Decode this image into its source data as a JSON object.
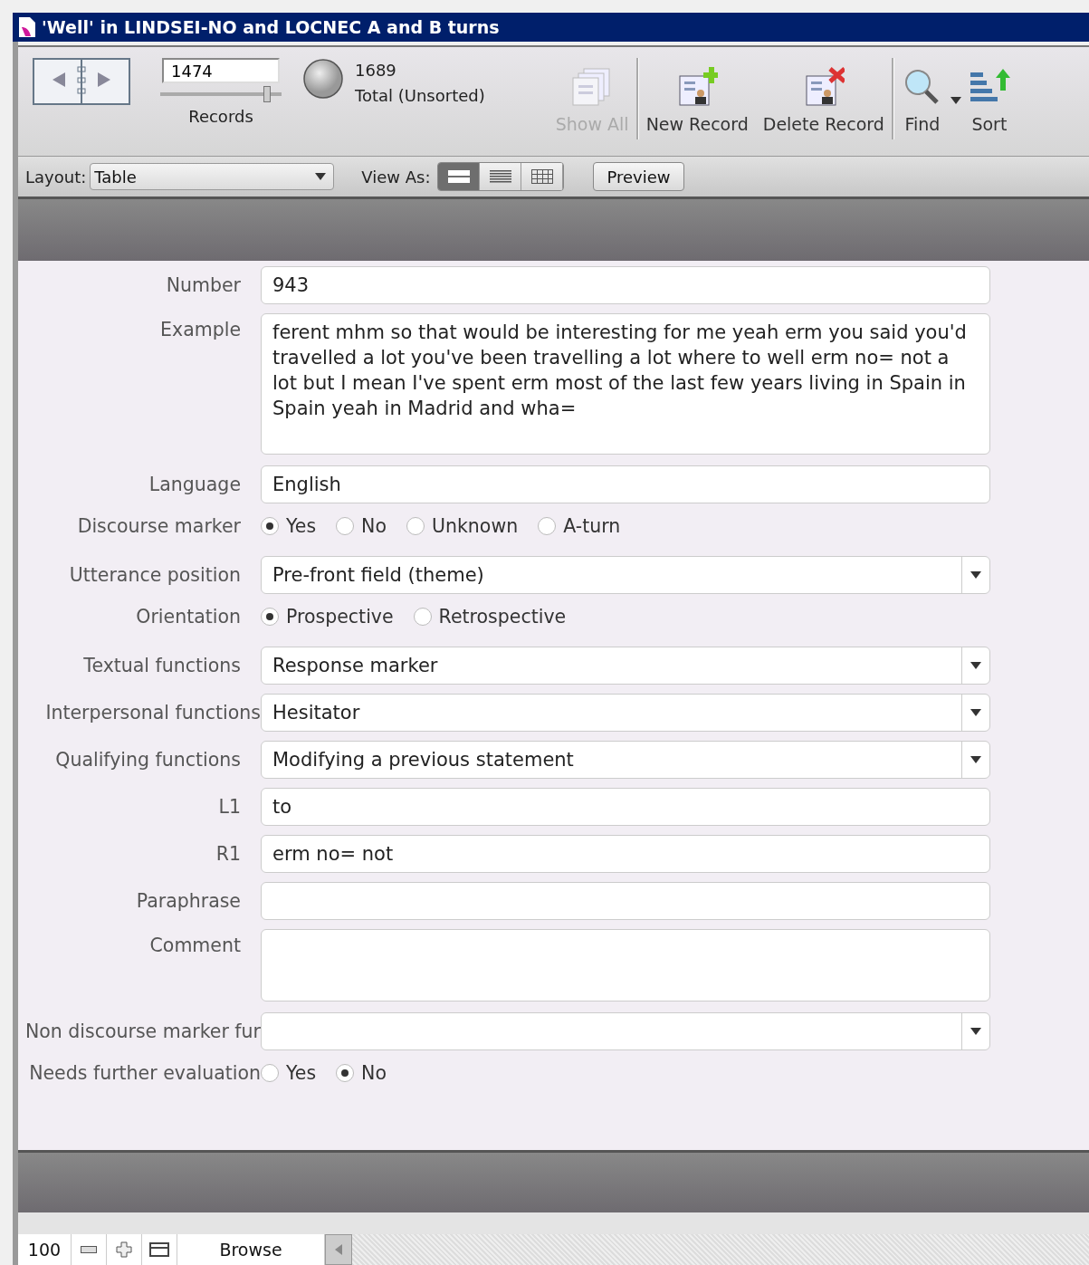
{
  "window": {
    "title": "'Well' in LINDSEI-NO and LOCNEC A and B turns"
  },
  "toolbar": {
    "record_number": "1474",
    "records_slider": {
      "level": 0.87
    },
    "records_label": "Records",
    "total_count": "1689",
    "total_label": "Total (Unsorted)",
    "buttons": [
      {
        "kind": "showall",
        "label": "Show All",
        "disabled": true
      },
      {
        "kind": "new",
        "label": "New Record",
        "disabled": false
      },
      {
        "kind": "delete",
        "label": "Delete Record",
        "disabled": false
      },
      {
        "kind": "find",
        "label": "Find",
        "disabled": false
      },
      {
        "kind": "sort",
        "label": "Sort",
        "disabled": false
      }
    ]
  },
  "layout_bar": {
    "layout_label": "Layout:",
    "layout_value": "Table",
    "view_as_label": "View As:",
    "view_modes": [
      {
        "kind": "form",
        "selected": true
      },
      {
        "kind": "list",
        "selected": false
      },
      {
        "kind": "table",
        "selected": false
      }
    ],
    "preview_button": "Preview"
  },
  "form": {
    "fields": [
      {
        "kind": "text",
        "label": "Number",
        "value": "943"
      },
      {
        "kind": "textarea",
        "label": "Example",
        "value": "ferent mhm so that would be interesting for me yeah erm you said you'd travelled a lot you've been travelling a lot where to well erm no= not a lot but I mean I've spent erm most of the last few years living in Spain in Spain yeah in Madrid and wha="
      },
      {
        "kind": "text",
        "label": "Language",
        "value": "English"
      },
      {
        "kind": "radio",
        "label": "Discourse marker",
        "options": [
          {
            "label": "Yes",
            "selected": true
          },
          {
            "label": "No",
            "selected": false
          },
          {
            "label": "Unknown",
            "selected": false
          },
          {
            "label": "A-turn",
            "selected": false
          }
        ]
      },
      {
        "kind": "select",
        "label": "Utterance position",
        "value": "Pre-front field (theme)"
      },
      {
        "kind": "radio",
        "label": "Orientation",
        "options": [
          {
            "label": "Prospective",
            "selected": true
          },
          {
            "label": "Retrospective",
            "selected": false
          }
        ]
      },
      {
        "kind": "select",
        "label": "Textual functions",
        "value": "Response marker"
      },
      {
        "kind": "select",
        "label": "Interpersonal functions",
        "value": "Hesitator"
      },
      {
        "kind": "select",
        "label": "Qualifying functions",
        "value": "Modifying a previous statement"
      },
      {
        "kind": "text",
        "label": "L1",
        "value": "to"
      },
      {
        "kind": "text",
        "label": "R1",
        "value": "erm no= not"
      },
      {
        "kind": "text",
        "label": "Paraphrase"
      },
      {
        "kind": "textarea",
        "label": "Comment"
      },
      {
        "kind": "select",
        "label": "Non discourse marker fur"
      },
      {
        "kind": "radio",
        "label": "Needs further evaluation",
        "options": [
          {
            "label": "Yes",
            "selected": false
          },
          {
            "label": "No",
            "selected": true
          }
        ]
      }
    ]
  },
  "status_bar": {
    "zoom": "100",
    "mode": "Browse"
  }
}
